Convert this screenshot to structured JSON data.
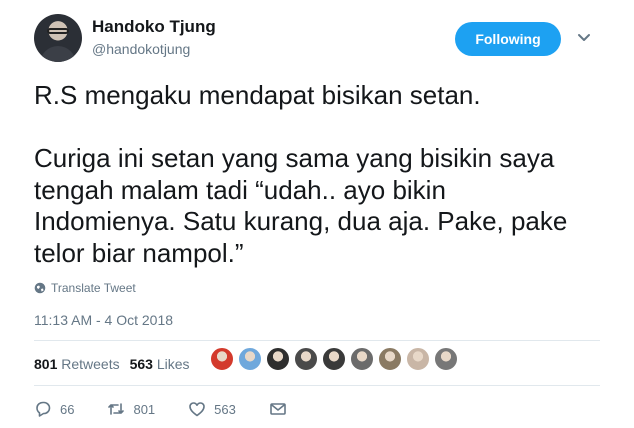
{
  "author": {
    "name": "Handoko Tjung",
    "handle": "@handokotjung"
  },
  "follow_button_label": "Following",
  "tweet": {
    "text": "R.S mengaku mendapat bisikan setan.\n\nCuriga ini setan yang sama yang bisikin saya\ntengah malam tadi “udah.. ayo bikin\nIndomienya. Satu kurang, dua aja. Pake, pake\ntelor biar nampol.”",
    "translate_label": "Translate Tweet",
    "timestamp": "11:13 AM - 4 Oct 2018"
  },
  "stats": {
    "retweets_count": "801",
    "retweets_label": "Retweets",
    "likes_count": "563",
    "likes_label": "Likes"
  },
  "liker_avatars": [
    {
      "color": "#d33a2c"
    },
    {
      "color": "#6fa8dc"
    },
    {
      "color": "#2e2e2e"
    },
    {
      "color": "#4a4a4a"
    },
    {
      "color": "#3a3a3a"
    },
    {
      "color": "#6b6b6b"
    },
    {
      "color": "#8a7a63"
    },
    {
      "color": "#c9b6a6"
    },
    {
      "color": "#777777"
    }
  ],
  "actions": {
    "reply_count": "66",
    "retweet_count": "801",
    "like_count": "563"
  },
  "colors": {
    "accent": "#1da1f2",
    "muted": "#657786",
    "text": "#14171a",
    "divider": "#e1e8ed"
  }
}
